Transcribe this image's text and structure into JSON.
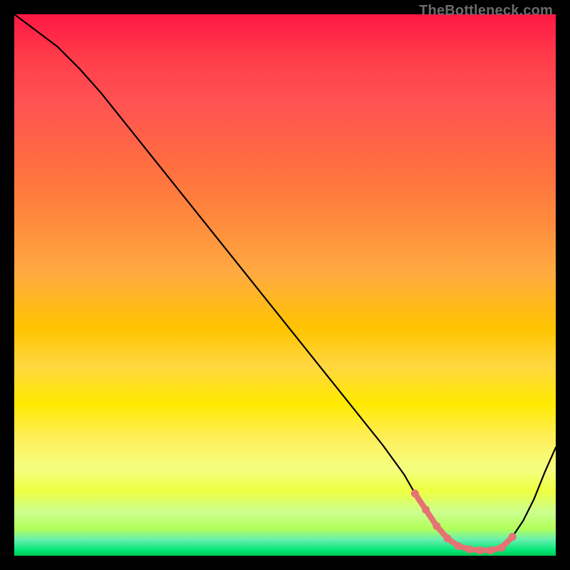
{
  "attribution": "TheBottleneck.com",
  "colors": {
    "curve_stroke": "#000000",
    "marker_fill": "#e57373",
    "marker_stroke": "#c94f4f",
    "background_top": "#ff1744",
    "background_bottom": "#00c853"
  },
  "chart_data": {
    "type": "line",
    "title": "",
    "xlabel": "",
    "ylabel": "",
    "xlim": [
      0,
      100
    ],
    "ylim": [
      0,
      100
    ],
    "grid": false,
    "series": [
      {
        "name": "bottleneck",
        "x": [
          0,
          4,
          8,
          12,
          16,
          20,
          24,
          28,
          32,
          36,
          40,
          44,
          48,
          52,
          56,
          60,
          64,
          68,
          72,
          74,
          76,
          78,
          80,
          82,
          84,
          86,
          88,
          90,
          92,
          94,
          96,
          98,
          100
        ],
        "y": [
          100,
          97,
          94,
          90,
          85.5,
          80.5,
          75.5,
          70.5,
          65.5,
          60.5,
          55.5,
          50.5,
          45.5,
          40.5,
          35.5,
          30.5,
          25.5,
          20.5,
          15,
          11.5,
          8.5,
          5.5,
          3.2,
          1.8,
          1.2,
          1.0,
          1.0,
          1.5,
          3.5,
          6.5,
          10.5,
          15.5,
          20.0
        ]
      }
    ],
    "markers": {
      "series": "bottleneck",
      "x": [
        74,
        76,
        78,
        80,
        82,
        84,
        86,
        88,
        90,
        92
      ],
      "style": "dot"
    }
  }
}
